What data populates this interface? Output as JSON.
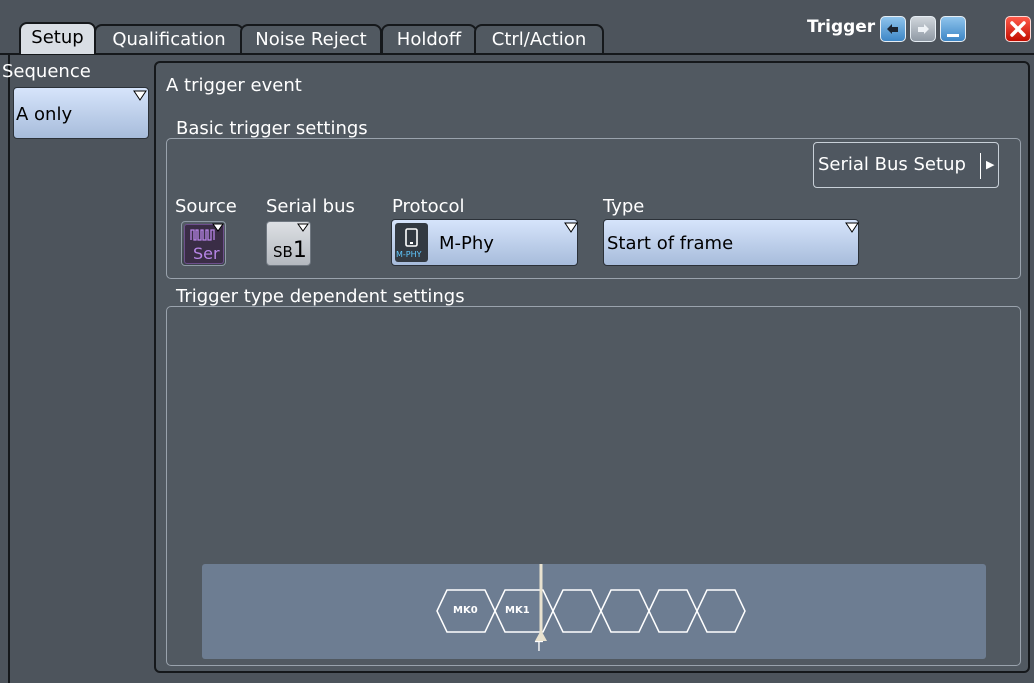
{
  "window": {
    "title": "Trigger"
  },
  "tabs": [
    {
      "label": "Setup",
      "active": true
    },
    {
      "label": "Qualification",
      "active": false
    },
    {
      "label": "Noise Reject",
      "active": false
    },
    {
      "label": "Holdoff",
      "active": false
    },
    {
      "label": "Ctrl/Action",
      "active": false
    }
  ],
  "window_buttons": [
    "undo-icon",
    "redo-icon",
    "minimize-icon",
    "close-icon"
  ],
  "sequence": {
    "label": "Sequence",
    "value": "A only"
  },
  "main": {
    "event_title": "A trigger event",
    "basic": {
      "label": "Basic trigger settings",
      "serial_bus_setup": "Serial Bus Setup",
      "source": {
        "label": "Source",
        "value": "Ser"
      },
      "serial_bus": {
        "label": "Serial bus",
        "prefix": "SB",
        "number": "1"
      },
      "protocol": {
        "label": "Protocol",
        "value": "M-Phy",
        "icon_caption": "M-PHY"
      },
      "type": {
        "label": "Type",
        "value": "Start of frame"
      }
    },
    "dependent": {
      "label": "Trigger type dependent settings",
      "frame_fields": [
        "MK0",
        "MK1",
        "",
        "",
        "",
        ""
      ],
      "trigger_marker": "T"
    }
  },
  "colors": {
    "background": "#4d545c",
    "panel": "#515961",
    "accent_blue": "#a7bcdb",
    "serial_purple": "#b785e6",
    "close_red": "#d91a0a"
  }
}
